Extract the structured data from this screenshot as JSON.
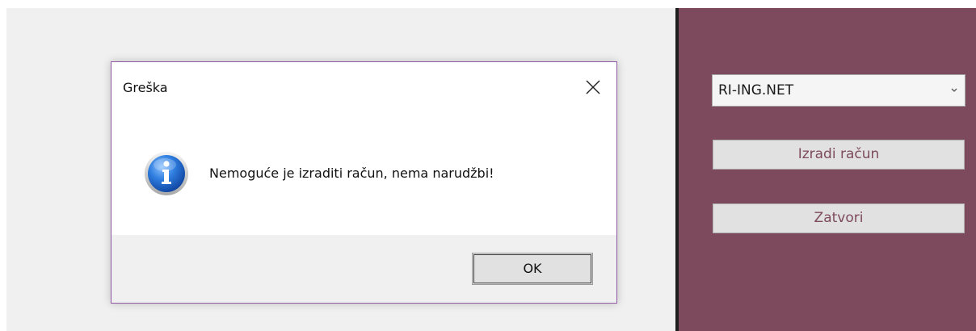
{
  "dialog": {
    "title": "Greška",
    "message": "Nemoguće je izraditi račun, nema narudžbi!",
    "ok_label": "OK",
    "icon": "info-icon",
    "close_icon": "close-icon"
  },
  "side_panel": {
    "combo_value": "RI-ING.NET",
    "create_invoice_label": "Izradi račun",
    "close_label": "Zatvori",
    "background_color": "#7d4a5d"
  },
  "colors": {
    "dialog_border": "#9158a6",
    "info_blue": "#1f62c8"
  }
}
